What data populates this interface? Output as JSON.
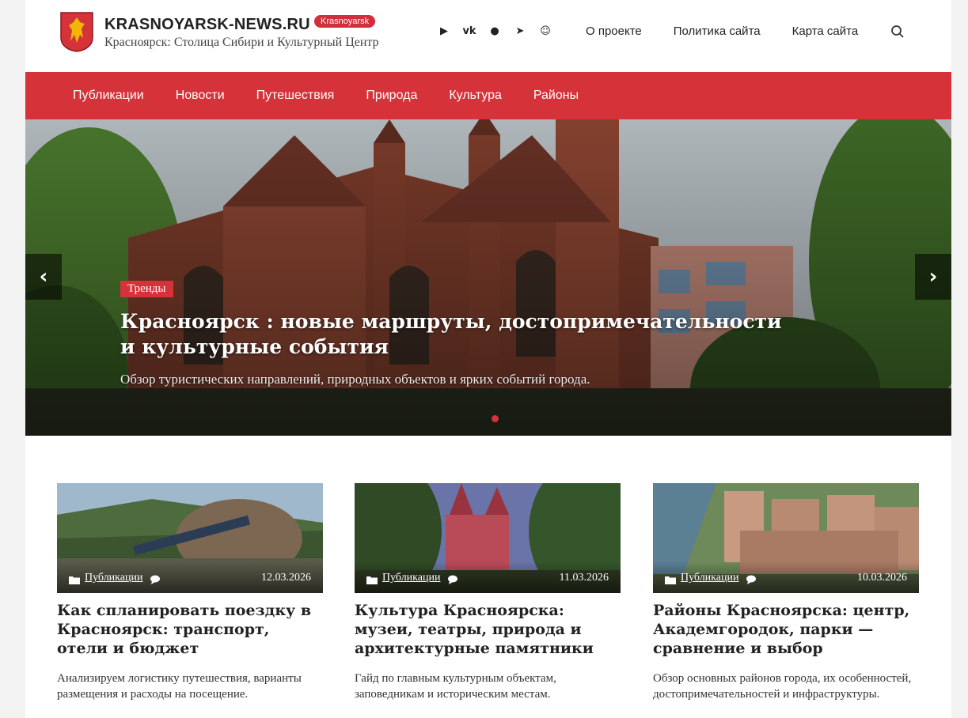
{
  "header": {
    "site_title": "KRASNOYARSK-NEWS.RU",
    "badge": "Krasnoyarsk",
    "tagline": "Красноярск: Столица Сибири и Культурный Центр",
    "social_icons": [
      "telegram-arrow-icon",
      "vk-icon",
      "ok-icon",
      "telegram-icon",
      "smile-icon"
    ],
    "top_links": [
      "О проекте",
      "Политика сайта",
      "Карта сайта"
    ],
    "colors": {
      "accent": "#d6323a"
    }
  },
  "nav": {
    "items": [
      "Публикации",
      "Новости",
      "Путешествия",
      "Природа",
      "Культура",
      "Районы"
    ]
  },
  "hero": {
    "badge": "Тренды",
    "title": "Красноярск : новые маршруты, достопримечательности и культурные события",
    "subtitle": "Обзор туристических направлений, природных объектов и ярких событий города.",
    "prev_icon": "chevron-left-icon",
    "next_icon": "chevron-right-icon"
  },
  "cards": [
    {
      "category": "Публикации",
      "date": "12.03.2026",
      "title": "Как спланировать поездку в Красноярск: транспорт, отели и бюджет",
      "excerpt": "Анализируем логистику путешествия, варианты размещения и расходы на посещение."
    },
    {
      "category": "Публикации",
      "date": "11.03.2026",
      "title": "Культура Красноярска: музеи, театры, природа и архитектурные памятники",
      "excerpt": "Гайд по главным культурным объектам, заповедникам и историческим местам."
    },
    {
      "category": "Публикации",
      "date": "10.03.2026",
      "title": "Районы Красноярска: центр, Академгородок, парки — сравнение и выбор",
      "excerpt": "Обзор основных районов города, их особенностей, достопримечательностей и инфраструктуры."
    }
  ]
}
